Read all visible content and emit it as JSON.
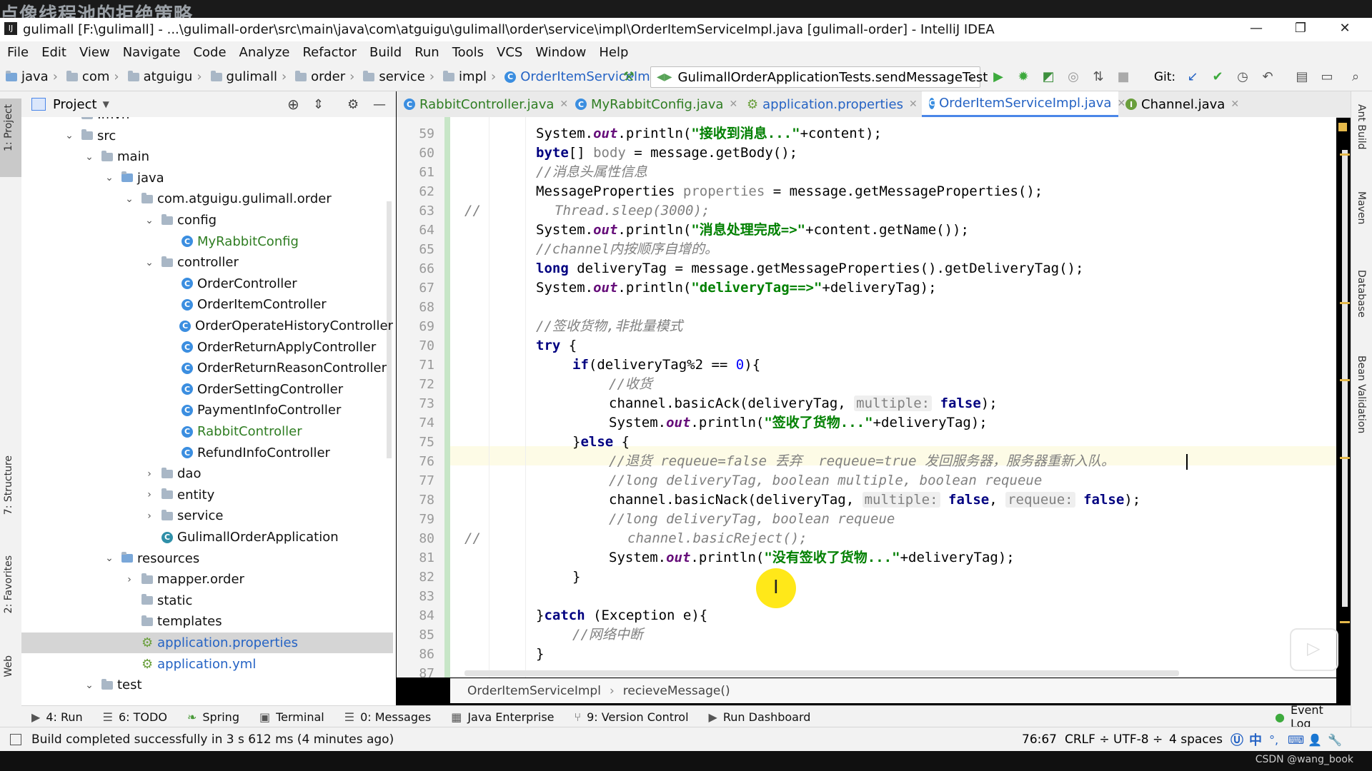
{
  "overlay_title": "点像线程池的拒绝策略",
  "window": {
    "title": "gulimall [F:\\gulimall] - ...\\gulimall-order\\src\\main\\java\\com\\atguigu\\gulimall\\order\\service\\impl\\OrderItemServiceImpl.java [gulimall-order] - IntelliJ IDEA",
    "minimize": "—",
    "restore": "❐",
    "close": "✕"
  },
  "menu": [
    "File",
    "Edit",
    "View",
    "Navigate",
    "Code",
    "Analyze",
    "Refactor",
    "Build",
    "Run",
    "Tools",
    "VCS",
    "Window",
    "Help"
  ],
  "nav_breadcrumb": [
    "java",
    "com",
    "atguigu",
    "gulimall",
    "order",
    "service",
    "impl",
    "OrderItemServiceImpl"
  ],
  "run_config": "GulimallOrderApplicationTests.sendMessageTest",
  "git_label": "Git:",
  "project_panel": {
    "title": "Project"
  },
  "tree": [
    {
      "label": ".mvn",
      "indent": 0,
      "arrow": "›",
      "type": "folder"
    },
    {
      "label": "src",
      "indent": 0,
      "arrow": "⌄",
      "type": "folder"
    },
    {
      "label": "main",
      "indent": 1,
      "arrow": "⌄",
      "type": "folder"
    },
    {
      "label": "java",
      "indent": 2,
      "arrow": "⌄",
      "type": "folder"
    },
    {
      "label": "com.atguigu.gulimall.order",
      "indent": 3,
      "arrow": "⌄",
      "type": "folder"
    },
    {
      "label": "config",
      "indent": 4,
      "arrow": "⌄",
      "type": "folder"
    },
    {
      "label": "MyRabbitConfig",
      "indent": 5,
      "arrow": "",
      "type": "class-green"
    },
    {
      "label": "controller",
      "indent": 4,
      "arrow": "⌄",
      "type": "folder"
    },
    {
      "label": "OrderController",
      "indent": 5,
      "arrow": "",
      "type": "class"
    },
    {
      "label": "OrderItemController",
      "indent": 5,
      "arrow": "",
      "type": "class"
    },
    {
      "label": "OrderOperateHistoryController",
      "indent": 5,
      "arrow": "",
      "type": "class"
    },
    {
      "label": "OrderReturnApplyController",
      "indent": 5,
      "arrow": "",
      "type": "class"
    },
    {
      "label": "OrderReturnReasonController",
      "indent": 5,
      "arrow": "",
      "type": "class"
    },
    {
      "label": "OrderSettingController",
      "indent": 5,
      "arrow": "",
      "type": "class"
    },
    {
      "label": "PaymentInfoController",
      "indent": 5,
      "arrow": "",
      "type": "class"
    },
    {
      "label": "RabbitController",
      "indent": 5,
      "arrow": "",
      "type": "class-green"
    },
    {
      "label": "RefundInfoController",
      "indent": 5,
      "arrow": "",
      "type": "class"
    },
    {
      "label": "dao",
      "indent": 4,
      "arrow": "›",
      "type": "folder"
    },
    {
      "label": "entity",
      "indent": 4,
      "arrow": "›",
      "type": "folder"
    },
    {
      "label": "service",
      "indent": 4,
      "arrow": "›",
      "type": "folder"
    },
    {
      "label": "GulimallOrderApplication",
      "indent": 4,
      "arrow": "",
      "type": "app"
    },
    {
      "label": "resources",
      "indent": 2,
      "arrow": "⌄",
      "type": "folder"
    },
    {
      "label": "mapper.order",
      "indent": 3,
      "arrow": "›",
      "type": "folder"
    },
    {
      "label": "static",
      "indent": 3,
      "arrow": "",
      "type": "folder"
    },
    {
      "label": "templates",
      "indent": 3,
      "arrow": "",
      "type": "folder"
    },
    {
      "label": "application.properties",
      "indent": 3,
      "arrow": "",
      "type": "props-selected"
    },
    {
      "label": "application.yml",
      "indent": 3,
      "arrow": "",
      "type": "props"
    },
    {
      "label": "test",
      "indent": 1,
      "arrow": "⌄",
      "type": "folder"
    }
  ],
  "tabs": [
    {
      "label": "RabbitController.java",
      "color": "#2f7d22"
    },
    {
      "label": "MyRabbitConfig.java",
      "color": "#2f7d22"
    },
    {
      "label": "application.properties",
      "color": "#2563c4"
    },
    {
      "label": "OrderItemServiceImpl.java",
      "color": "#2563c4"
    },
    {
      "label": "Channel.java",
      "color": "#111111"
    }
  ],
  "line_numbers": [
    "59",
    "60",
    "61",
    "62",
    "63",
    "64",
    "65",
    "66",
    "67",
    "68",
    "69",
    "70",
    "71",
    "72",
    "73",
    "74",
    "75",
    "76",
    "77",
    "78",
    "79",
    "80",
    "81",
    "82",
    "83",
    "84",
    "85",
    "86",
    "87"
  ],
  "code": {
    "l59_a": "System.",
    "l59_b": "out",
    "l59_c": ".println(",
    "l59_d": "\"接收到消息...\"",
    "l59_e": "+content);",
    "l60_a": "byte",
    "l60_b": "[] ",
    "l60_c": "body",
    "l60_d": " = message.getBody();",
    "l61": "//消息头属性信息",
    "l62_a": "MessageProperties ",
    "l62_b": "properties",
    "l62_c": " = message.getMessageProperties();",
    "l63_a": "//",
    "l63_b": "Thread.sleep(3000);",
    "l64_a": "System.",
    "l64_b": "out",
    "l64_c": ".println(",
    "l64_d": "\"消息处理完成=>\"",
    "l64_e": "+content.getName());",
    "l65": "//channel内按顺序自增的。",
    "l66_a": "long",
    "l66_b": " deliveryTag = message.getMessageProperties().getDeliveryTag();",
    "l67_a": "System.",
    "l67_b": "out",
    "l67_c": ".println(",
    "l67_d": "\"deliveryTag==>\"",
    "l67_e": "+deliveryTag);",
    "l69": "//签收货物,非批量模式",
    "l70_a": "try",
    "l70_b": " {",
    "l71_a": "if",
    "l71_b": "(deliveryTag%2 == ",
    "l71_c": "0",
    "l71_d": "){",
    "l72": "//收货",
    "l73_a": "channel.basicAck(deliveryTag, ",
    "l73_h": "multiple:",
    "l73_b": " ",
    "l73_c": "false",
    "l73_d": ");",
    "l74_a": "System.",
    "l74_b": "out",
    "l74_c": ".println(",
    "l74_d": "\"签收了货物...\"",
    "l74_e": "+deliveryTag);",
    "l75_a": "}",
    "l75_b": "else",
    "l75_c": " {",
    "l76": "//退货 requeue=false 丢弃  requeue=true 发回服务器，服务器重新入队。",
    "l77": "//long deliveryTag, boolean multiple, boolean requeue",
    "l78_a": "channel.basicNack(deliveryTag, ",
    "l78_h1": "multiple:",
    "l78_b": " ",
    "l78_c": "false",
    "l78_d": ", ",
    "l78_h2": "requeue:",
    "l78_e": " ",
    "l78_f": "false",
    "l78_g": ");",
    "l79": "//long deliveryTag, boolean requeue",
    "l80_a": "//",
    "l80_b": "channel.basicReject();",
    "l81_a": "System.",
    "l81_b": "out",
    "l81_c": ".println(",
    "l81_d": "\"没有签收了货物...\"",
    "l81_e": "+deliveryTag);",
    "l82": "}",
    "l84_a": "}",
    "l84_b": "catch",
    "l84_c": " (Exception e){",
    "l85": "//网络中断",
    "l86": "}"
  },
  "editor_breadcrumb": [
    "OrderItemServiceImpl",
    "recieveMessage()"
  ],
  "left_strip": [
    "1: Project",
    "7: Structure",
    "2: Favorites",
    "Web"
  ],
  "right_strip": [
    "Ant Build",
    "Maven",
    "Database",
    "Bean Validation"
  ],
  "tool_windows": [
    {
      "icon": "▶",
      "label": "4: Run"
    },
    {
      "icon": "☰",
      "label": "6: TODO"
    },
    {
      "icon": "❧",
      "label": "Spring"
    },
    {
      "icon": "▣",
      "label": "Terminal"
    },
    {
      "icon": "☰",
      "label": "0: Messages"
    },
    {
      "icon": "▦",
      "label": "Java Enterprise"
    },
    {
      "icon": "⑂",
      "label": "9: Version Control"
    },
    {
      "icon": "▶",
      "label": "Run Dashboard"
    }
  ],
  "event_log": "Event Log",
  "status": {
    "message": "Build completed successfully in 3 s 612 ms (4 minutes ago)",
    "position": "76:67",
    "line_sep": "CRLF ÷",
    "encoding": "UTF-8 ÷",
    "indent": "4 spaces",
    "ime": "中"
  },
  "watermark": "CSDN @wang_book"
}
